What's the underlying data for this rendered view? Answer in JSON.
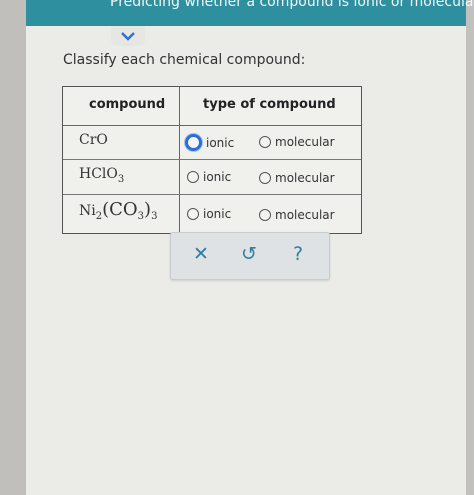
{
  "header": {
    "title": "Predicting whether a compound is ionic or molecular"
  },
  "prompt": "Classify each chemical compound:",
  "table": {
    "col_compound": "compound",
    "col_type": "type of compound",
    "rows": [
      {
        "formula": "CrO",
        "ionic_label": "ionic",
        "molecular_label": "molecular"
      },
      {
        "formula_main": "HClO",
        "formula_sub": "3",
        "ionic_label": "ionic",
        "molecular_label": "molecular"
      },
      {
        "f1": "Ni",
        "s1": "2",
        "f2": "(CO",
        "s2": "3",
        "f3": ")",
        "s3": "3",
        "ionic_label": "ionic",
        "molecular_label": "molecular"
      }
    ]
  },
  "actions": {
    "clear": "✕",
    "undo": "↺",
    "help": "?"
  },
  "colors": {
    "accent": "#2e8f9f",
    "focus": "#2b6fd6"
  },
  "icons": {
    "collapse": "chevron-down-icon"
  }
}
